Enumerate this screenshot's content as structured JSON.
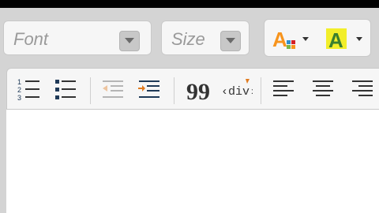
{
  "toolbar": {
    "font_combo": {
      "label": "Font"
    },
    "size_combo": {
      "label": "Size"
    },
    "colors": {
      "text_color_button": {
        "icon": "text-color-icon",
        "glyph": "A",
        "swatch_colors": [
          "#f7941d",
          "#2e8fce",
          "#d41f26",
          "#7ab648"
        ]
      },
      "bg_color_button": {
        "icon": "background-color-icon",
        "glyph": "A",
        "highlight": "#f2ee2a",
        "glyph_color": "#3a7f2e"
      }
    },
    "list_buttons": [
      {
        "name": "numbered-list-button",
        "icon": "numbered-list-icon"
      },
      {
        "name": "bulleted-list-button",
        "icon": "bulleted-list-icon"
      }
    ],
    "indent_buttons": [
      {
        "name": "decrease-indent-button",
        "icon": "outdent-icon",
        "enabled": false
      },
      {
        "name": "increase-indent-button",
        "icon": "indent-icon",
        "enabled": true
      }
    ],
    "block_buttons": [
      {
        "name": "blockquote-button",
        "icon": "quote-icon",
        "glyph": "99"
      },
      {
        "name": "create-div-button",
        "icon": "div-container-icon",
        "glyph": "div"
      }
    ],
    "align_buttons": [
      {
        "name": "align-left-button",
        "icon": "align-left-icon"
      },
      {
        "name": "align-center-button",
        "icon": "align-center-icon"
      },
      {
        "name": "align-right-button",
        "icon": "align-right-icon"
      }
    ]
  },
  "editor": {
    "content": ""
  }
}
